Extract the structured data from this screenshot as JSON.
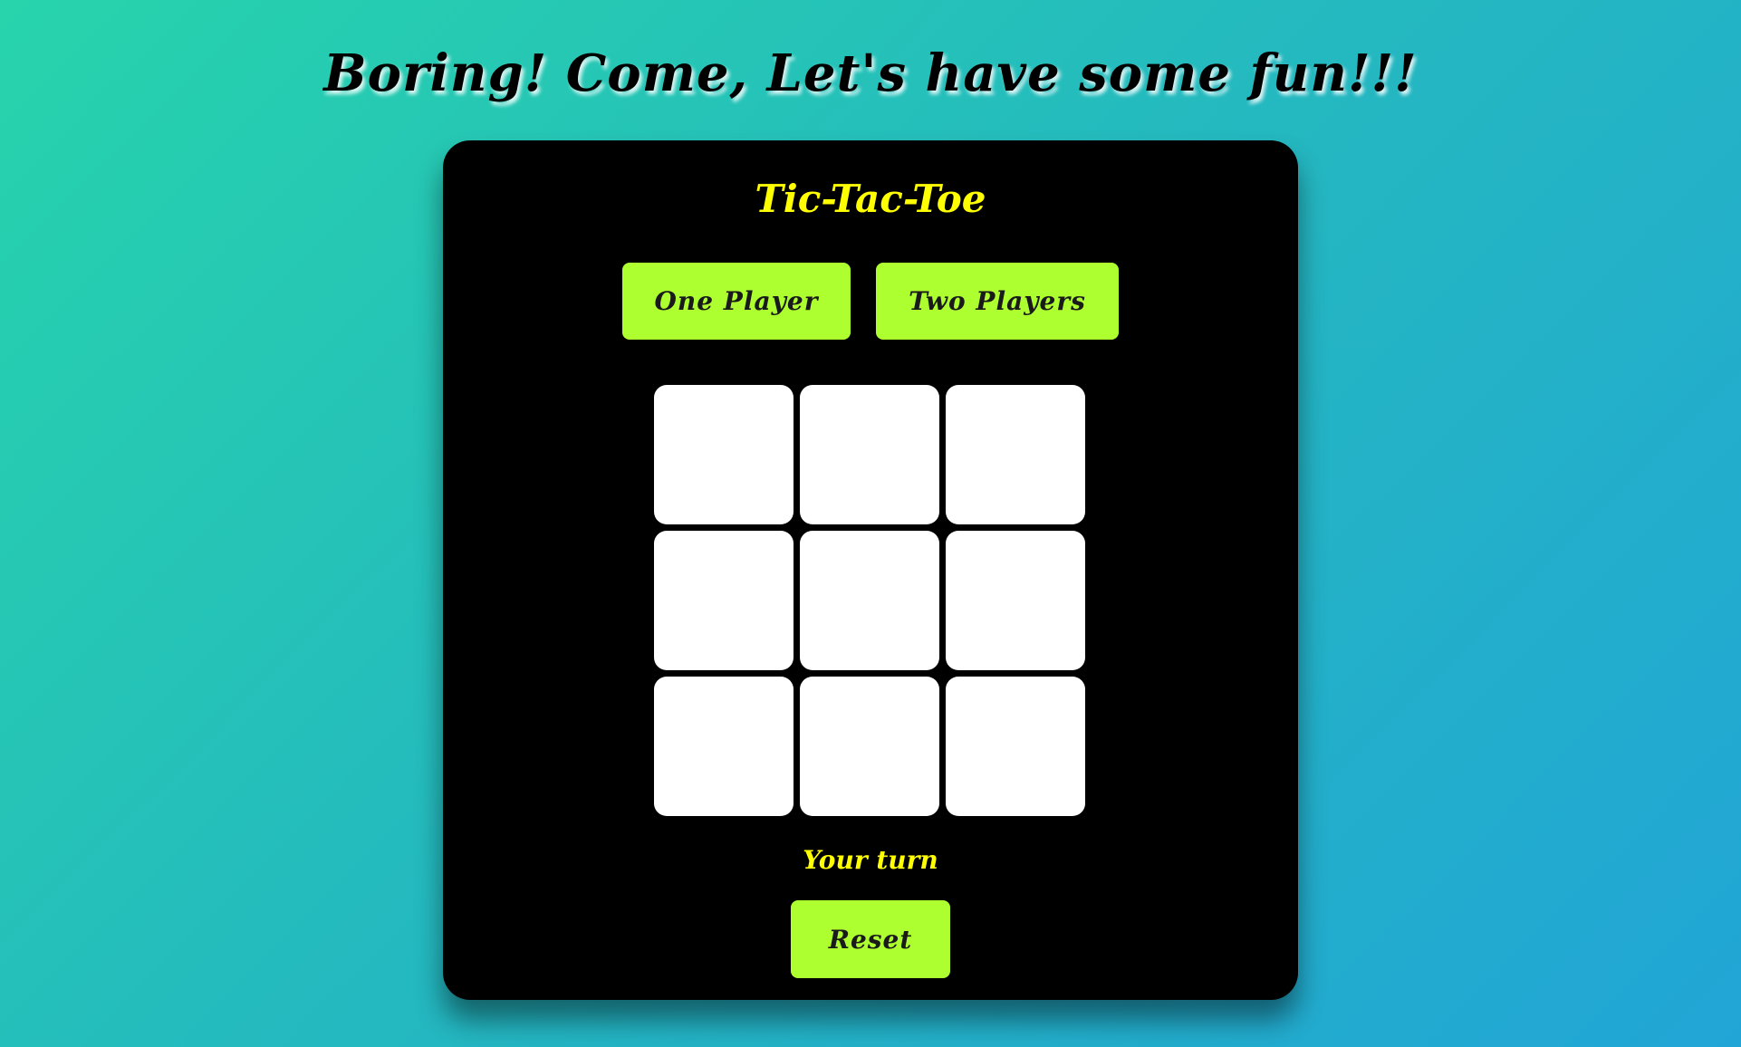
{
  "page": {
    "headline": "Boring! Come, Let's have some fun!!!"
  },
  "game": {
    "title": "Tic-Tac-Toe",
    "modes": {
      "one_player": "One Player",
      "two_players": "Two Players"
    },
    "board": {
      "cells": [
        "",
        "",
        "",
        "",
        "",
        "",
        "",
        "",
        ""
      ]
    },
    "status": "Your turn",
    "reset_label": "Reset"
  },
  "colors": {
    "background_gradient": [
      "#27d4ab",
      "#21a5d6"
    ],
    "card": "#000000",
    "accent_text": "#ffff00",
    "button": "#adff2f",
    "cell": "#ffffff"
  }
}
